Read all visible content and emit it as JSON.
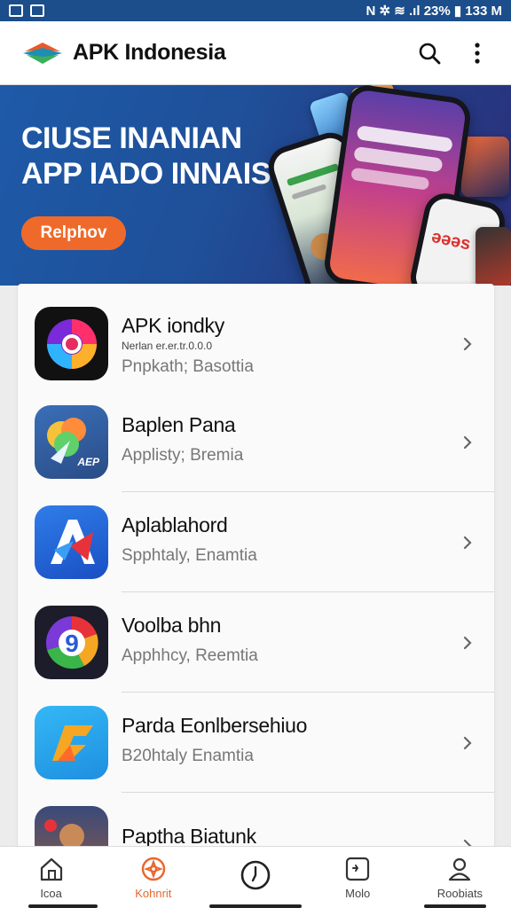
{
  "status_bar": {
    "right_text": "N  ✲  ≋ .ıl 23%  ▮ 133 M"
  },
  "app_bar": {
    "title": "APK Indonesia",
    "search_icon": "search-icon",
    "menu_icon": "more-vert-icon"
  },
  "banner": {
    "title_line1": "CIUSE INANIAN",
    "title_line2": "APP IADO INNAIS",
    "button_label": "Relphov",
    "phone_text": "ǝǝǝs"
  },
  "apps": [
    {
      "name": "APK iondky",
      "tiny": "Nerlan er.er.tr.0.0.0",
      "sub": "Pnpkath; Basottia"
    },
    {
      "name": "Baplen Pana",
      "sub": "Applisty; Bremia",
      "icon_text": "AEP"
    },
    {
      "name": "Aplablahord",
      "sub": "Spphtaly, Enamtia"
    },
    {
      "name": "Voolba bhn",
      "sub": "Apphhcy, Reemtia"
    },
    {
      "name": "Parda Eonlbersehiuo",
      "sub": "B20htaly Enamtia"
    },
    {
      "name": "Paptha Biatunk",
      "sub": ""
    }
  ],
  "bottom_nav": [
    {
      "label": "Icoa",
      "icon": "home-icon"
    },
    {
      "label": "Kohnrit",
      "icon": "compass-icon"
    },
    {
      "label": "",
      "icon": "clock-icon"
    },
    {
      "label": "Molo",
      "icon": "download-icon"
    },
    {
      "label": "Roobiats",
      "icon": "profile-icon"
    }
  ],
  "colors": {
    "accent": "#ef6a2a",
    "banner": "#1e5aa8",
    "status_bar": "#1b4e8a"
  }
}
